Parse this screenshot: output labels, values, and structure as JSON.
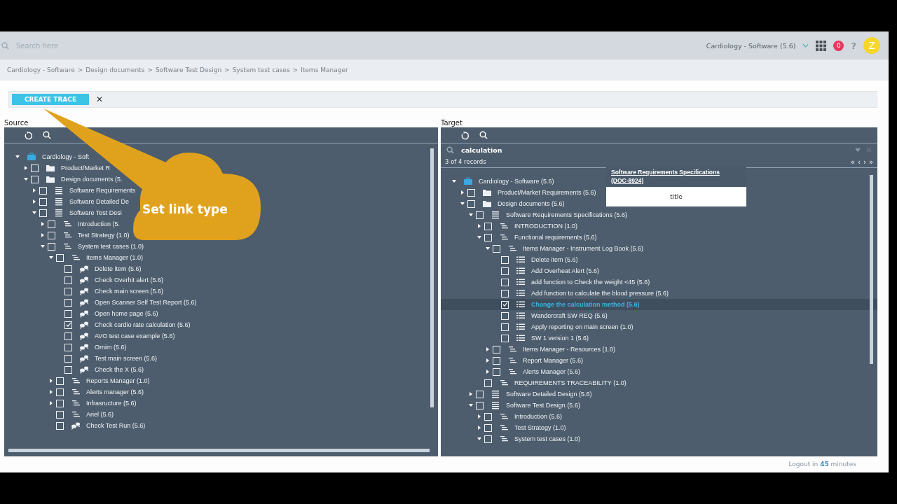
{
  "header": {
    "search": {
      "placeholder": "Search here"
    },
    "project": "Cardiology - Software (5.6)",
    "notifications": "0",
    "help": "?",
    "avatar": "Z"
  },
  "breadcrumb": {
    "items": [
      "Cardiology - Software",
      "Design documents",
      "Software Test Design",
      "System test cases",
      "Items Manager"
    ],
    "separators": [
      ">",
      ">",
      ">",
      ">"
    ]
  },
  "toolbar": {
    "create_button": "CREATE TRACE",
    "close": "✕"
  },
  "callout": {
    "text": "Set link type"
  },
  "source": {
    "label": "Source",
    "tree": [
      {
        "label": "Cardiology - Soft",
        "kind": "root",
        "expanded": true,
        "children": [
          {
            "label": "Product/Market R",
            "kind": "folder",
            "expanded": false,
            "checked": false
          },
          {
            "label": "Design documents (5.",
            "kind": "folder",
            "expanded": true,
            "checked": false,
            "children": [
              {
                "label": "Software Requirements",
                "kind": "doc",
                "expanded": false,
                "checked": false
              },
              {
                "label": "Software Detailed De",
                "kind": "doc",
                "expanded": false,
                "checked": false
              },
              {
                "label": "Software Test Desi",
                "kind": "doc",
                "expanded": true,
                "checked": false,
                "children": [
                  {
                    "label": "Introduction (5.",
                    "kind": "section",
                    "expanded": false,
                    "checked": false
                  },
                  {
                    "label": "Test Strategy (1.0)",
                    "kind": "section",
                    "expanded": false,
                    "checked": false
                  },
                  {
                    "label": "System test cases (1.0)",
                    "kind": "section",
                    "expanded": true,
                    "checked": false,
                    "children": [
                      {
                        "label": "Items Manager (1.0)",
                        "kind": "section",
                        "expanded": true,
                        "checked": false,
                        "children": [
                          {
                            "label": "Delete item (5.6)",
                            "kind": "testcase",
                            "checked": false
                          },
                          {
                            "label": "Check Overhit alert (5.6)",
                            "kind": "testcase",
                            "checked": false
                          },
                          {
                            "label": "Check main screen (5.6)",
                            "kind": "testcase",
                            "checked": false
                          },
                          {
                            "label": "Open Scanner Self Test Report (5.6)",
                            "kind": "testcase",
                            "checked": false
                          },
                          {
                            "label": "Open home page (5.6)",
                            "kind": "testcase",
                            "checked": false
                          },
                          {
                            "label": "Check cardio rate calculation (5.6)",
                            "kind": "testcase",
                            "checked": true
                          },
                          {
                            "label": "AVO test case example (5.6)",
                            "kind": "testcase",
                            "checked": false
                          },
                          {
                            "label": "Ornim (5.6)",
                            "kind": "testcase",
                            "checked": false
                          },
                          {
                            "label": "Test main screen (5.6)",
                            "kind": "testcase",
                            "checked": false
                          },
                          {
                            "label": "Check the X (5.6)",
                            "kind": "testcase",
                            "checked": false
                          }
                        ]
                      },
                      {
                        "label": "Reports Manager (1.0)",
                        "kind": "section",
                        "expanded": false,
                        "checked": false
                      },
                      {
                        "label": "Alerts manager (5.6)",
                        "kind": "section",
                        "expanded": false,
                        "checked": false
                      },
                      {
                        "label": "Infrasructure (5.6)",
                        "kind": "section",
                        "expanded": false,
                        "checked": false
                      },
                      {
                        "label": "Ariel (5.6)",
                        "kind": "section",
                        "checked": false
                      },
                      {
                        "label": "Check Test Run (5.6)",
                        "kind": "testcase",
                        "checked": false
                      }
                    ]
                  }
                ]
              }
            ]
          }
        ]
      }
    ]
  },
  "target": {
    "label": "Target",
    "search": {
      "value": "calculation"
    },
    "records": "3 of 4 records",
    "pager": [
      "«",
      "‹",
      "›",
      "»"
    ],
    "tooltip": {
      "link": "Software Requirements Specifications (DOC-8924)",
      "field": "title"
    },
    "tree": [
      {
        "label": "Cardiology - Software (5.6)",
        "kind": "root",
        "expanded": true,
        "selected": false,
        "children": [
          {
            "label": "Product/Market Requirements (5.6)",
            "kind": "folder",
            "expanded": false,
            "checked": false,
            "selected": false
          },
          {
            "label": "Design documents (5.6)",
            "kind": "folder",
            "expanded": true,
            "checked": false,
            "selected": false,
            "children": [
              {
                "label": "Software Requirements Specifications (5.6)",
                "kind": "doc",
                "expanded": true,
                "checked": false,
                "selected": false,
                "children": [
                  {
                    "label": "INTRODUCTION (1.0)",
                    "kind": "section",
                    "expanded": false,
                    "checked": false,
                    "selected": false
                  },
                  {
                    "label": "Functional requirements (5.6)",
                    "kind": "section",
                    "expanded": true,
                    "checked": false,
                    "selected": false,
                    "children": [
                      {
                        "label": "Items Manager - Instrument Log Book (5.6)",
                        "kind": "section",
                        "expanded": true,
                        "checked": false,
                        "selected": false,
                        "children": [
                          {
                            "label": "Delete item (5.6)",
                            "kind": "item",
                            "checked": false,
                            "selected": false
                          },
                          {
                            "label": "Add Overheat Alert (5.6)",
                            "kind": "item",
                            "checked": false,
                            "selected": false
                          },
                          {
                            "label": "add function to Check the weight <45 (5.6)",
                            "kind": "item",
                            "checked": false,
                            "selected": false
                          },
                          {
                            "label": "Add function to calculate the blood pressure (5.6)",
                            "kind": "item",
                            "checked": false,
                            "selected": false
                          },
                          {
                            "label": "Change the calculation method (5.6)",
                            "kind": "item",
                            "checked": true,
                            "selected": true
                          },
                          {
                            "label": "Wandercraft SW REQ (5.6)",
                            "kind": "item",
                            "checked": false,
                            "selected": false
                          },
                          {
                            "label": "Apply reporting on main screen (1.0)",
                            "kind": "item",
                            "checked": false,
                            "selected": false
                          },
                          {
                            "label": "SW 1 version 1 (5.6)",
                            "kind": "item",
                            "checked": false,
                            "selected": false
                          }
                        ]
                      },
                      {
                        "label": "Items Manager - Resources (1.0)",
                        "kind": "section",
                        "expanded": false,
                        "checked": false,
                        "selected": false
                      },
                      {
                        "label": "Report Manager (5.6)",
                        "kind": "section",
                        "expanded": false,
                        "checked": false,
                        "selected": false
                      },
                      {
                        "label": "Alerts Manager (5.6)",
                        "kind": "section",
                        "expanded": false,
                        "checked": false,
                        "selected": false
                      }
                    ]
                  },
                  {
                    "label": "REQUIREMENTS TRACEABILITY (1.0)",
                    "kind": "section",
                    "checked": false,
                    "selected": false
                  }
                ]
              },
              {
                "label": "Software Detailed Design (5.6)",
                "kind": "doc",
                "expanded": false,
                "checked": false,
                "selected": false
              },
              {
                "label": "Software Test Design (5.6)",
                "kind": "doc",
                "expanded": true,
                "checked": false,
                "selected": false,
                "children": [
                  {
                    "label": "Introduction (5.6)",
                    "kind": "section",
                    "expanded": false,
                    "checked": false,
                    "selected": false
                  },
                  {
                    "label": "Test Strategy (1.0)",
                    "kind": "section",
                    "expanded": false,
                    "checked": false,
                    "selected": false
                  },
                  {
                    "label": "System test cases (1.0)",
                    "kind": "section",
                    "expanded": true,
                    "checked": false,
                    "selected": false
                  }
                ]
              }
            ]
          }
        ]
      }
    ]
  },
  "footer": {
    "label": "Logout in",
    "minutes": "45",
    "unit": "minutes"
  }
}
